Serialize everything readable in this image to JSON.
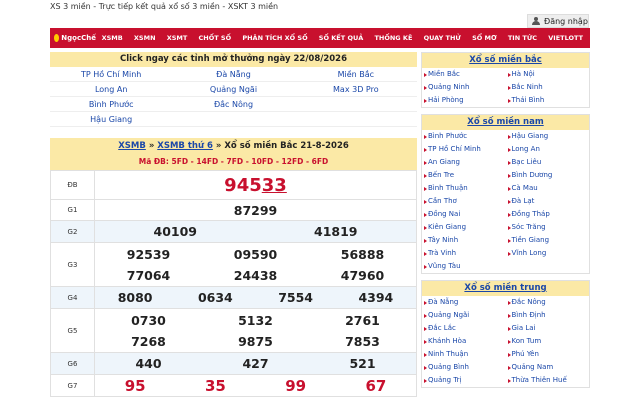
{
  "header": {
    "title": "XS 3 miền - Trực tiếp kết quả xổ số 3 miền - XSKT 3 miền",
    "login_label": "Đăng nhập"
  },
  "nav": {
    "logo": "NgọcChế",
    "items": [
      "XSMB",
      "XSMN",
      "XSMT",
      "CHỐT SỐ",
      "PHÂN TÍCH XỔ SỐ",
      "SỐ KẾT QUẢ",
      "THỐNG KÊ",
      "QUAY THỬ",
      "SỔ MƠ",
      "TIN TỨC",
      "VIETLOTT"
    ]
  },
  "provinces": {
    "heading": "Click ngay các tỉnh mở thưởng ngày 22/08/2026",
    "items": [
      "TP Hồ Chí Minh",
      "Đà Nẵng",
      "Miền Bắc",
      "Long An",
      "Quảng Ngãi",
      "Max 3D Pro",
      "Bình Phước",
      "Đắc Nông",
      "",
      "Hậu Giang",
      "",
      ""
    ]
  },
  "result": {
    "crumb1": "XSMB",
    "sep": "»",
    "crumb2": "XSMB thứ 6",
    "crumb3": "Xổ số miền Bắc 21-8-2026",
    "code": "Mã ĐB: 5FD - 14FD - 7FD - 10FD - 12FD - 6FD",
    "db_label": "ĐB",
    "db_prefix": "945",
    "db_suffix": "33",
    "g1_label": "G1",
    "g1": "87299",
    "g2_label": "G2",
    "g2": [
      "40109",
      "41819"
    ],
    "g3_label": "G3",
    "g3": [
      "92539",
      "09590",
      "56888",
      "77064",
      "24438",
      "47960"
    ],
    "g4_label": "G4",
    "g4": [
      "8080",
      "0634",
      "7554",
      "4394"
    ],
    "g5_label": "G5",
    "g5": [
      "0730",
      "5132",
      "2761",
      "7268",
      "9875",
      "7853"
    ],
    "g6_label": "G6",
    "g6": [
      "440",
      "427",
      "521"
    ],
    "g7_label": "G7",
    "g7": [
      "95",
      "35",
      "99",
      "67"
    ]
  },
  "sidebar": {
    "mb_title": "Xổ số miền bắc",
    "mb": [
      "Miền Bắc",
      "Hà Nội",
      "Quảng Ninh",
      "Bắc Ninh",
      "Hải Phòng",
      "Thái Bình"
    ],
    "mn_title": "Xổ số miền nam",
    "mn": [
      "Bình Phước",
      "Hậu Giang",
      "TP Hồ Chí Minh",
      "Long An",
      "An Giang",
      "Bạc Liêu",
      "Bến Tre",
      "Bình Dương",
      "Bình Thuận",
      "Cà Mau",
      "Cần Thơ",
      "Đà Lạt",
      "Đồng Nai",
      "Đồng Tháp",
      "Kiên Giang",
      "Sóc Trăng",
      "Tây Ninh",
      "Tiền Giang",
      "Trà Vinh",
      "Vĩnh Long",
      "Vũng Tàu",
      ""
    ],
    "mt_title": "Xổ số miền trung",
    "mt": [
      "Đà Nẵng",
      "Đắc Nông",
      "Quảng Ngãi",
      "Bình Định",
      "Đắc Lắc",
      "Gia Lai",
      "Khánh Hòa",
      "Kon Tum",
      "Ninh Thuận",
      "Phú Yên",
      "Quảng Bình",
      "Quảng Nam",
      "Quảng Trị",
      "Thừa Thiên Huế"
    ]
  },
  "colors": {
    "brand_red": "#c8102e",
    "highlight_yellow": "#fbe9a6",
    "link_blue": "#1a47a8"
  }
}
